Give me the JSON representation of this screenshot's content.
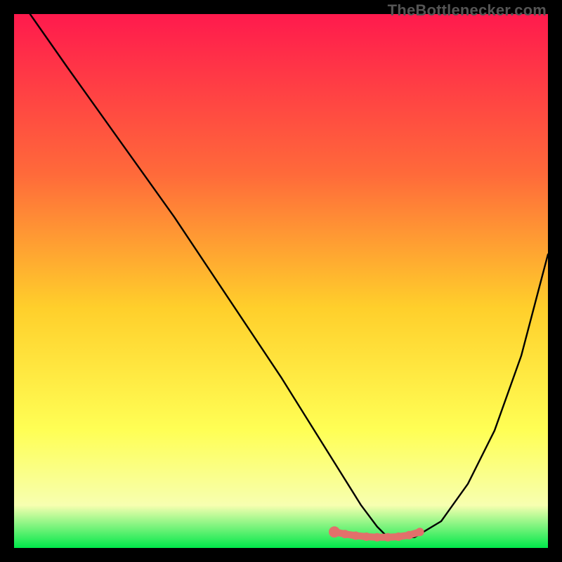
{
  "watermark": "TheBottlenecker.com",
  "colors": {
    "top": "#ff1a4d",
    "mid1": "#ff6a3a",
    "mid2": "#ffcf2b",
    "mid3": "#ffff55",
    "mid4": "#f7ffb0",
    "bottom": "#00e84a",
    "curve": "#000000",
    "highlight": "#e2706b",
    "frame": "#000000"
  },
  "chart_data": {
    "type": "line",
    "title": "",
    "xlabel": "",
    "ylabel": "",
    "xlim": [
      0,
      100
    ],
    "ylim": [
      0,
      100
    ],
    "grid": false,
    "legend": false,
    "series": [
      {
        "name": "bottleneck-curve",
        "x": [
          3,
          10,
          20,
          30,
          40,
          50,
          55,
          60,
          65,
          68,
          70,
          72,
          75,
          80,
          85,
          90,
          95,
          100
        ],
        "y": [
          100,
          90,
          76,
          62,
          47,
          32,
          24,
          16,
          8,
          4,
          2,
          2,
          2,
          5,
          12,
          22,
          36,
          55
        ]
      }
    ],
    "annotations": [
      {
        "name": "valley-highlight",
        "type": "dotted-segment",
        "x": [
          60,
          62,
          64,
          66,
          68,
          70,
          72,
          74,
          76
        ],
        "y": [
          3.0,
          2.6,
          2.3,
          2.1,
          2.0,
          2.0,
          2.1,
          2.4,
          3.0
        ]
      }
    ]
  }
}
